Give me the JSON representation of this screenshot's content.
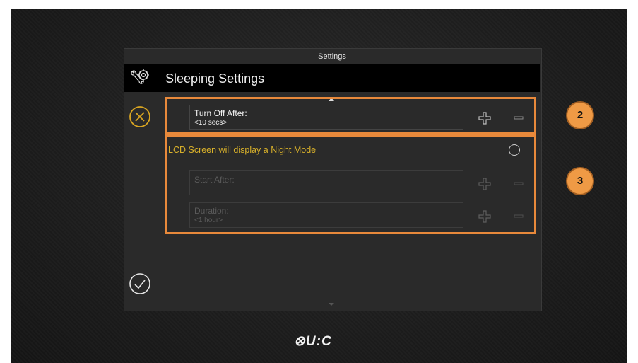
{
  "window": {
    "title": "Settings"
  },
  "header": {
    "title": "Sleeping Settings",
    "icon": "tools-gear-icon"
  },
  "turn_off": {
    "label": "Turn Off After:",
    "value": "<10 secs>"
  },
  "night_mode": {
    "label": "LCD Screen will display a Night Mode",
    "enabled": false
  },
  "start_after": {
    "label": "Start After:",
    "value": ""
  },
  "duration": {
    "label": "Duration:",
    "value": "<1 hour>"
  },
  "callouts": {
    "badge_2": "2",
    "badge_3": "3"
  },
  "brand": {
    "logo": "⊗U:C"
  },
  "colors": {
    "accent_gold": "#d9b12a",
    "callout_orange": "#e8893b",
    "badge_fill": "#ef9a45"
  }
}
